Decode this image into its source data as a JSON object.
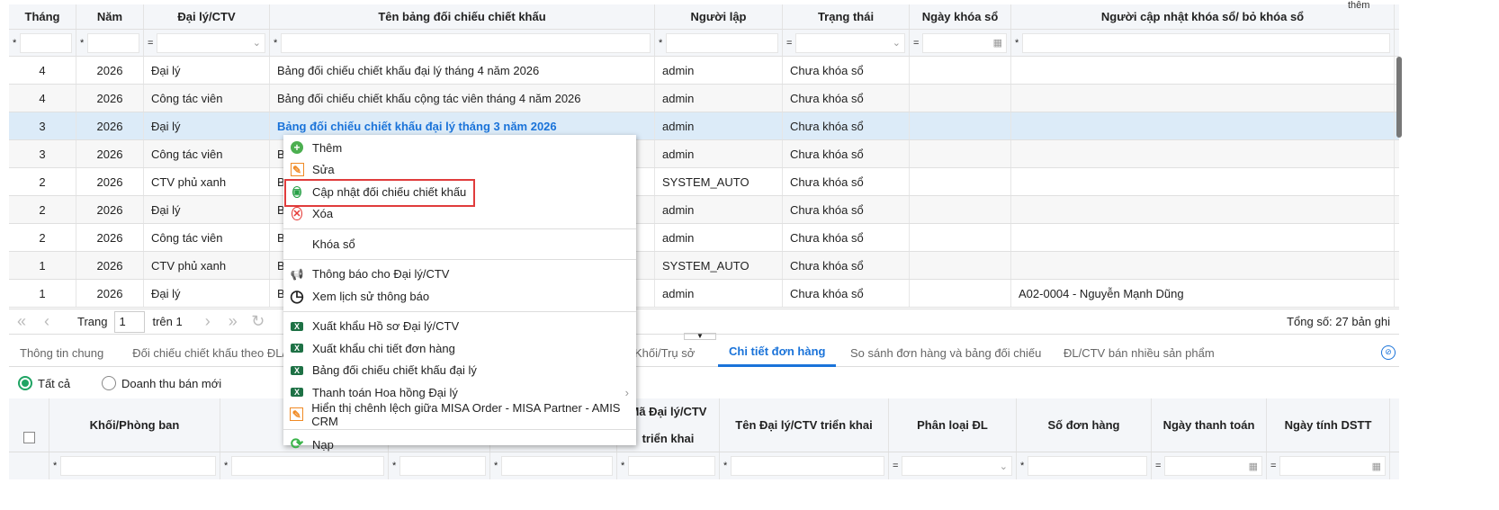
{
  "top_right_text": "thêm",
  "grid": {
    "columns": [
      "Tháng",
      "Năm",
      "Đại lý/CTV",
      "Tên bảng đối chiếu chiết khấu",
      "Người lập",
      "Trạng thái",
      "Ngày khóa sổ",
      "Người cập nhật khóa sổ/ bỏ khóa sổ"
    ],
    "filter_ops": [
      "*",
      "*",
      "=",
      "*",
      "*",
      "=",
      "=",
      "*"
    ],
    "rows": [
      [
        "4",
        "2026",
        "Đại lý",
        "Bảng đối chiếu chiết khấu đại lý tháng 4 năm 2026",
        "admin",
        "Chưa khóa sổ",
        "",
        ""
      ],
      [
        "4",
        "2026",
        "Công tác viên",
        "Bảng đối chiếu chiết khấu cộng tác viên tháng 4 năm 2026",
        "admin",
        "Chưa khóa sổ",
        "",
        ""
      ],
      [
        "3",
        "2026",
        "Đại lý",
        "Bảng đối chiếu chiết khấu đại lý tháng 3 năm 2026",
        "admin",
        "Chưa khóa sổ",
        "",
        ""
      ],
      [
        "3",
        "2026",
        "Công tác viên",
        "B",
        "admin",
        "Chưa khóa sổ",
        "",
        ""
      ],
      [
        "2",
        "2026",
        "CTV phủ xanh",
        "B",
        "SYSTEM_AUTO",
        "Chưa khóa sổ",
        "",
        ""
      ],
      [
        "2",
        "2026",
        "Đại lý",
        "B",
        "admin",
        "Chưa khóa sổ",
        "",
        ""
      ],
      [
        "2",
        "2026",
        "Công tác viên",
        "B",
        "admin",
        "Chưa khóa sổ",
        "",
        ""
      ],
      [
        "1",
        "2026",
        "CTV phủ xanh",
        "B",
        "SYSTEM_AUTO",
        "Chưa khóa sổ",
        "",
        ""
      ],
      [
        "1",
        "2026",
        "Đại lý",
        "B",
        "admin",
        "Chưa khóa sổ",
        "",
        "A02-0004 - Nguyễn Mạnh Dũng"
      ]
    ]
  },
  "pager": {
    "page_label": "Trang",
    "page": "1",
    "of_label": "trên 1",
    "total": "Tổng số: 27 bản ghi"
  },
  "tabs": [
    "Thông tin chung",
    "Đối chiếu chiết khấu theo ĐL/C",
    "Khối/Trụ sở",
    "Chi tiết đơn hàng",
    "So sánh đơn hàng và bảng đối chiếu",
    "ĐL/CTV bán nhiều sản phẩm"
  ],
  "radios": [
    "Tất cả",
    "Doanh thu bán mới"
  ],
  "bottom_grid": {
    "columns": [
      "Khối/Phòng ban",
      "",
      "",
      "",
      "Mã Đại lý/CTV triển khai",
      "Tên Đại lý/CTV triển khai",
      "Phân loại ĐL",
      "Số đơn hàng",
      "Ngày thanh toán",
      "Ngày tính DSTT"
    ],
    "filter_ops": [
      "*",
      "*",
      "*",
      "*",
      "*",
      "*",
      "=",
      "*",
      "=",
      "="
    ]
  },
  "menu": {
    "items": [
      {
        "label": "Thêm",
        "icon": "add-icon"
      },
      {
        "label": "Sửa",
        "icon": "edit-icon"
      },
      {
        "label": "Cập nhật đối chiếu chiết khấu",
        "icon": "refresh-update-icon"
      },
      {
        "label": "Xóa",
        "icon": "delete-icon"
      },
      {
        "label": "Khóa sổ",
        "icon": ""
      },
      {
        "label": "Thông báo cho Đại lý/CTV",
        "icon": "megaphone-icon"
      },
      {
        "label": "Xem lịch sử thông báo",
        "icon": "clock-icon"
      },
      {
        "label": "Xuất khẩu Hồ sơ Đại lý/CTV",
        "icon": "excel-icon"
      },
      {
        "label": "Xuất khẩu chi tiết đơn hàng",
        "icon": "excel-icon"
      },
      {
        "label": "Bảng đối chiếu chiết khấu đại lý",
        "icon": "excel-icon"
      },
      {
        "label": "Thanh toán Hoa hồng Đại lý",
        "icon": "excel-icon"
      },
      {
        "label": "Hiển thị chênh lệch giữa MISA Order - MISA Partner - AMIS CRM",
        "icon": "edit-icon"
      },
      {
        "label": "Nạp",
        "icon": "reload-icon"
      }
    ]
  },
  "colors": {
    "accent": "#1a73d9",
    "highlight": "#e03c3c",
    "selected_row": "#dcebf8"
  }
}
